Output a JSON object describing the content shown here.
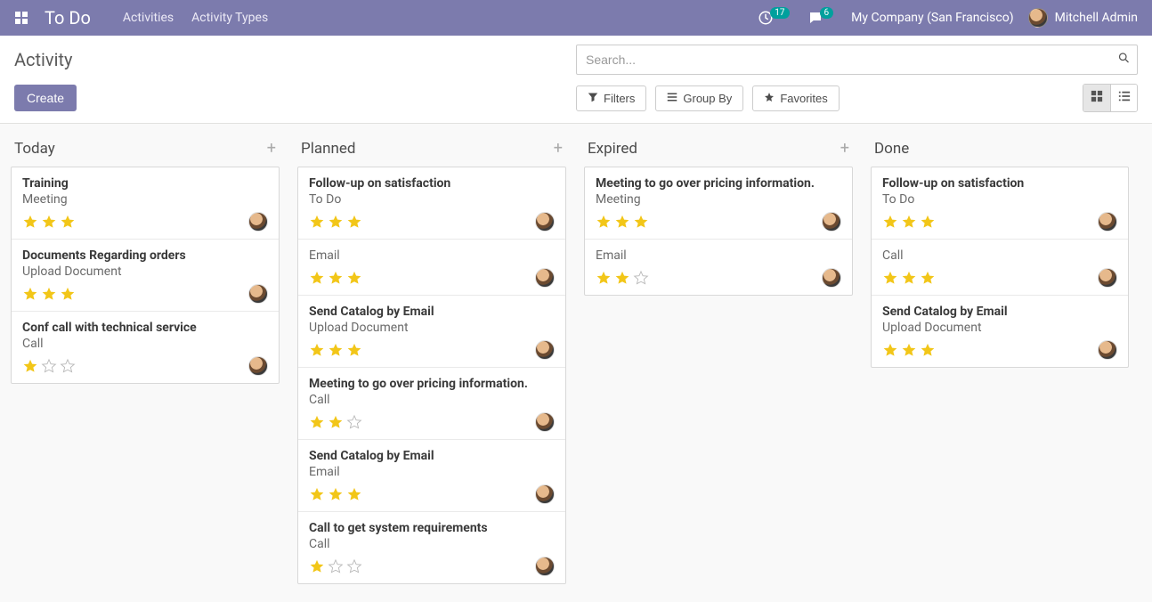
{
  "topbar": {
    "brand": "To Do",
    "nav": [
      "Activities",
      "Activity Types"
    ],
    "clock_badge": "17",
    "chat_badge": "6",
    "company": "My Company (San Francisco)",
    "user": "Mitchell Admin"
  },
  "control_panel": {
    "breadcrumb": "Activity",
    "create_label": "Create",
    "search_placeholder": "Search...",
    "filters_label": "Filters",
    "groupby_label": "Group By",
    "favorites_label": "Favorites"
  },
  "columns": [
    {
      "title": "Today",
      "has_add": true,
      "cards": [
        {
          "title": "Training",
          "subtitle": "Meeting",
          "stars": 3
        },
        {
          "title": "Documents Regarding orders",
          "subtitle": "Upload Document",
          "stars": 3
        },
        {
          "title": "Conf call with technical service",
          "subtitle": "Call",
          "stars": 1
        }
      ]
    },
    {
      "title": "Planned",
      "has_add": true,
      "cards": [
        {
          "title": "Follow-up on satisfaction",
          "subtitle": "To Do",
          "stars": 3
        },
        {
          "title": "",
          "subtitle": "Email",
          "stars": 3
        },
        {
          "title": "Send Catalog by Email",
          "subtitle": "Upload Document",
          "stars": 3
        },
        {
          "title": "Meeting to go over pricing information.",
          "subtitle": "Call",
          "stars": 2
        },
        {
          "title": "Send Catalog by Email",
          "subtitle": "Email",
          "stars": 3
        },
        {
          "title": "Call to get system requirements",
          "subtitle": "Call",
          "stars": 1
        }
      ]
    },
    {
      "title": "Expired",
      "has_add": true,
      "cards": [
        {
          "title": "Meeting to go over pricing information.",
          "subtitle": "Meeting",
          "stars": 3
        },
        {
          "title": "",
          "subtitle": "Email",
          "stars": 2
        }
      ]
    },
    {
      "title": "Done",
      "has_add": false,
      "cards": [
        {
          "title": "Follow-up on satisfaction",
          "subtitle": "To Do",
          "stars": 3
        },
        {
          "title": "",
          "subtitle": "Call",
          "stars": 3
        },
        {
          "title": "Send Catalog by Email",
          "subtitle": "Upload Document",
          "stars": 3
        }
      ]
    }
  ]
}
